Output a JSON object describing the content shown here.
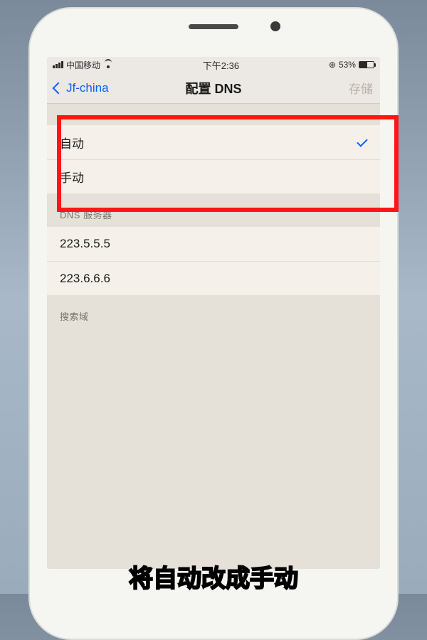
{
  "status": {
    "carrier": "中国移动",
    "time": "下午2:36",
    "battery_pct": "53%"
  },
  "nav": {
    "back_label": "Jf-china",
    "title": "配置 DNS",
    "action": "存储"
  },
  "mode_group": {
    "items": [
      {
        "label": "自动",
        "selected": true
      },
      {
        "label": "手动",
        "selected": false
      }
    ]
  },
  "dns_servers": {
    "header": "DNS 服务器",
    "items": [
      "223.5.5.5",
      "223.6.6.6"
    ]
  },
  "search_domains": {
    "header": "搜索域"
  },
  "caption": "将自动改成手动"
}
